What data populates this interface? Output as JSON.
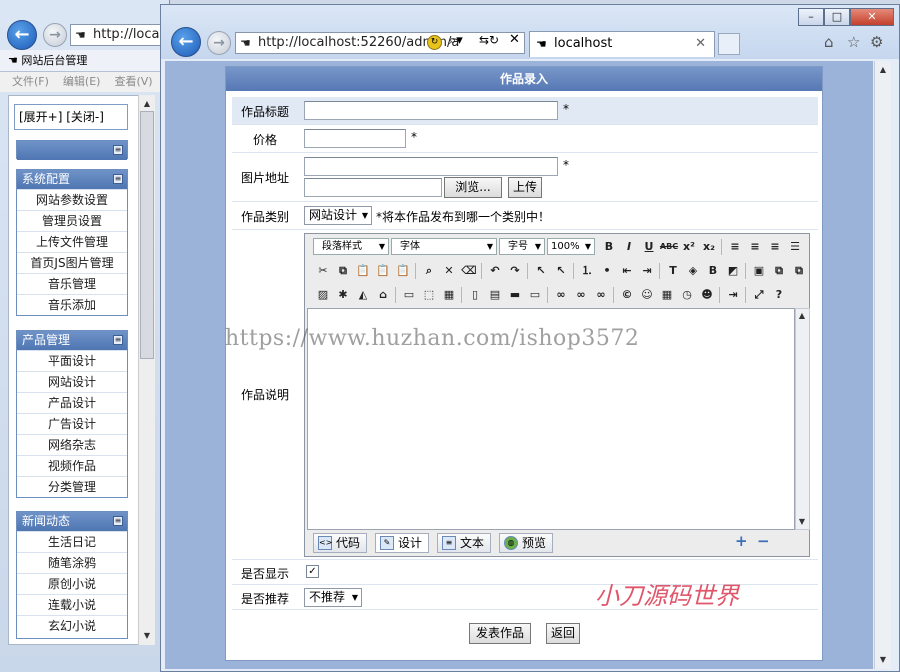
{
  "back_window": {
    "address": "http://localhost",
    "tab_title": "网站后台管理",
    "menu": [
      "文件(F)",
      "编辑(E)",
      "查看(V)"
    ]
  },
  "sidebar": {
    "expand_collapse": "[展开+] [关闭-]",
    "groups": [
      {
        "title": "系统配置",
        "items": [
          "网站参数设置",
          "管理员设置",
          "上传文件管理",
          "首页JS图片管理",
          "音乐管理",
          "音乐添加"
        ]
      },
      {
        "title": "产品管理",
        "items": [
          "平面设计",
          "网站设计",
          "产品设计",
          "广告设计",
          "网络杂志",
          "视频作品",
          "分类管理"
        ]
      },
      {
        "title": "新闻动态",
        "items": [
          "生活日记",
          "随笔涂鸦",
          "原创小说",
          "连载小说",
          "玄幻小说"
        ]
      }
    ]
  },
  "front_window": {
    "address": "http://localhost:52260/admin/a",
    "tab_title": "localhost"
  },
  "form": {
    "title": "作品录入",
    "fields": {
      "title_label": "作品标题",
      "price_label": "价格",
      "image_label": "图片地址",
      "category_label": "作品类别",
      "description_label": "作品说明",
      "show_label": "是否显示",
      "recommend_label": "是否推荐",
      "required_mark": "*"
    },
    "browse_button": "浏览...",
    "upload_button": "上传",
    "category_value": "网站设计",
    "category_hint": "*将本作品发布到哪一个类别中！",
    "recommend_value": "不推荐",
    "show_checked": true,
    "submit_button": "发表作品",
    "back_button": "返回"
  },
  "editor": {
    "format_combo": "段落样式",
    "font_combo": "字体",
    "size_combo": "字号",
    "zoom_combo": "100%",
    "tabs": [
      "代码",
      "设计",
      "文本",
      "预览"
    ]
  },
  "watermarks": {
    "url": "https://www.huzhan.com/ishop3572",
    "brand": "小刀源码世界"
  }
}
